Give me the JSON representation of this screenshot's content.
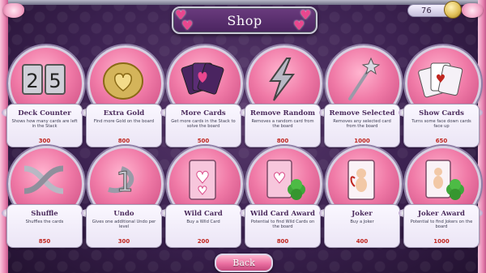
{
  "title": "Shop",
  "gold": {
    "value": "76",
    "icon": "coin-icon"
  },
  "back_label": "Back",
  "items": [
    {
      "name": "Deck Counter",
      "desc": "Shows how many cards are left in the Stack",
      "price": "300",
      "icon": "counter-25-icon"
    },
    {
      "name": "Extra Gold",
      "desc": "Find more Gold on the board",
      "price": "800",
      "icon": "gold-coin-heart-icon"
    },
    {
      "name": "More Cards",
      "desc": "Get more cards in the Stack to solve the board",
      "price": "500",
      "icon": "card-stack-icon"
    },
    {
      "name": "Remove Random",
      "desc": "Removes a random card from the board",
      "price": "800",
      "icon": "lightning-bolt-icon"
    },
    {
      "name": "Remove Selected",
      "desc": "Removes any selected card from the board",
      "price": "1000",
      "icon": "magic-wand-icon"
    },
    {
      "name": "Show Cards",
      "desc": "Turns some face down cards face up",
      "price": "650",
      "icon": "playing-cards-icon"
    },
    {
      "name": "Shuffle",
      "desc": "Shuffles the cards",
      "price": "850",
      "icon": "shuffle-arrows-icon"
    },
    {
      "name": "Undo",
      "desc": "Gives one additional Undo per level",
      "price": "300",
      "icon": "undo-one-icon"
    },
    {
      "name": "Wild Card",
      "desc": "Buy a Wild Card",
      "price": "200",
      "icon": "wild-card-hearts-icon"
    },
    {
      "name": "Wild Card Award",
      "desc": "Potential to find Wild Cards on the board",
      "price": "800",
      "icon": "wild-card-clover-icon"
    },
    {
      "name": "Joker",
      "desc": "Buy a Joker",
      "price": "400",
      "icon": "joker-cupid-icon"
    },
    {
      "name": "Joker Award",
      "desc": "Potential to find Jokers on the board",
      "price": "1000",
      "icon": "joker-clover-icon"
    }
  ],
  "colors": {
    "accent_pink": "#f07aa7",
    "price_red": "#c0261f",
    "background": "#3b2150"
  }
}
